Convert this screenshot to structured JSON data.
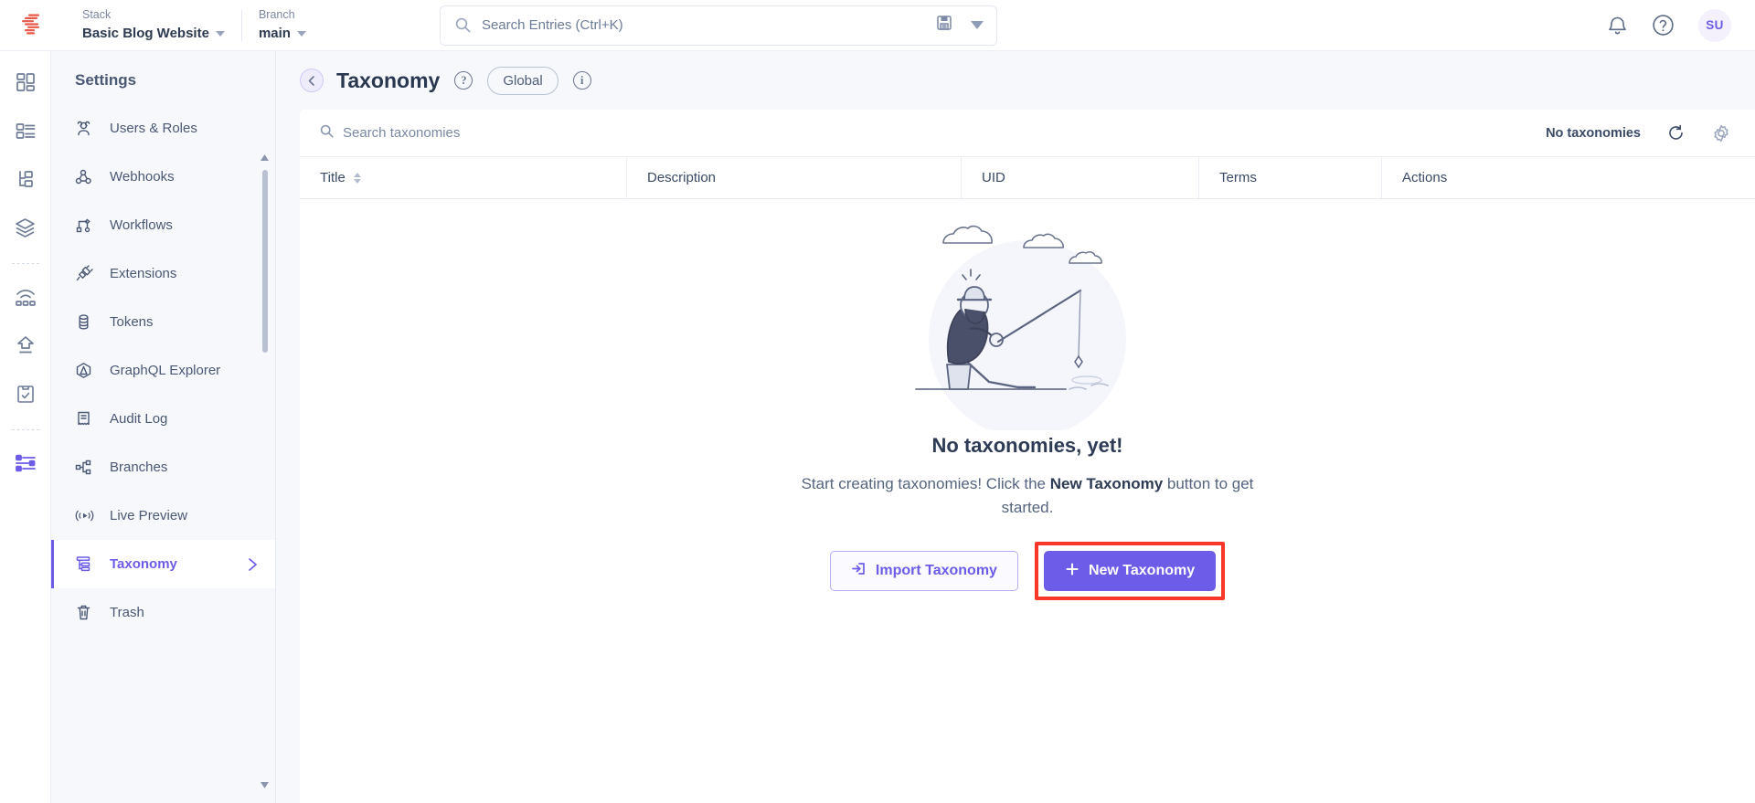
{
  "topbar": {
    "logo_icon": "contentstack-logo-icon",
    "stack": {
      "label": "Stack",
      "value": "Basic Blog Website"
    },
    "branch": {
      "label": "Branch",
      "value": "main"
    },
    "search": {
      "placeholder": "Search Entries (Ctrl+K)",
      "value": "",
      "save_icon": "floppy-disk-icon",
      "dropdown_icon": "caret-down-icon"
    },
    "notifications_icon": "bell-icon",
    "help_icon": "question-circle-icon",
    "avatar_initials": "SU"
  },
  "rail": {
    "items": [
      {
        "name": "dashboard-icon",
        "active": false
      },
      {
        "name": "content-types-icon",
        "active": false
      },
      {
        "name": "hierarchy-icon",
        "active": false
      },
      {
        "name": "stacks-layers-icon",
        "active": false
      },
      {
        "name": "live-preview-icon",
        "active": false
      },
      {
        "name": "releases-upload-icon",
        "active": false
      },
      {
        "name": "tasks-clipboard-icon",
        "active": false
      },
      {
        "name": "settings-sliders-icon",
        "active": true
      }
    ]
  },
  "sidebar": {
    "title": "Settings",
    "items": [
      {
        "label": "Users & Roles",
        "icon": "users-icon",
        "active": false
      },
      {
        "label": "Webhooks",
        "icon": "webhooks-icon",
        "active": false
      },
      {
        "label": "Workflows",
        "icon": "workflows-icon",
        "active": false
      },
      {
        "label": "Extensions",
        "icon": "extensions-plug-icon",
        "active": false
      },
      {
        "label": "Tokens",
        "icon": "tokens-database-icon",
        "active": false
      },
      {
        "label": "GraphQL Explorer",
        "icon": "graphql-icon",
        "active": false
      },
      {
        "label": "Audit Log",
        "icon": "audit-log-icon",
        "active": false
      },
      {
        "label": "Branches",
        "icon": "branches-icon",
        "active": false
      },
      {
        "label": "Live Preview",
        "icon": "live-preview-signal-icon",
        "active": false
      },
      {
        "label": "Taxonomy",
        "icon": "taxonomy-icon",
        "active": true,
        "chevron": "chevron-right-icon"
      },
      {
        "label": "Trash",
        "icon": "trash-icon",
        "active": false
      }
    ]
  },
  "page": {
    "back_icon": "chevron-left-icon",
    "title": "Taxonomy",
    "help_icon": "question-circle-icon",
    "scope_badge": "Global",
    "info_icon": "info-circle-icon"
  },
  "table": {
    "search_placeholder": "Search taxonomies",
    "search_value": "",
    "search_icon": "search-icon",
    "count_text": "No taxonomies",
    "refresh_icon": "refresh-icon",
    "settings_icon": "gear-icon",
    "columns": [
      {
        "label": "Title",
        "sortable": true
      },
      {
        "label": "Description",
        "sortable": false
      },
      {
        "label": "UID",
        "sortable": false
      },
      {
        "label": "Terms",
        "sortable": false
      },
      {
        "label": "Actions",
        "sortable": false
      }
    ],
    "rows": []
  },
  "empty_state": {
    "illustration": "person-fishing-illustration",
    "title": "No taxonomies, yet!",
    "description_part1": "Start creating taxonomies! Click the ",
    "description_bold": "New Taxonomy",
    "description_part2": " button to get started.",
    "import_button": {
      "label": "Import Taxonomy",
      "icon": "import-arrow-icon"
    },
    "new_button": {
      "label": "New Taxonomy",
      "icon": "plus-icon"
    }
  },
  "colors": {
    "accent_purple": "#6c5ce7",
    "highlight_red": "#f8372b",
    "page_bg": "#f7f8fc",
    "text_dark": "#2d3b54",
    "logo_red": "#e8594a"
  }
}
